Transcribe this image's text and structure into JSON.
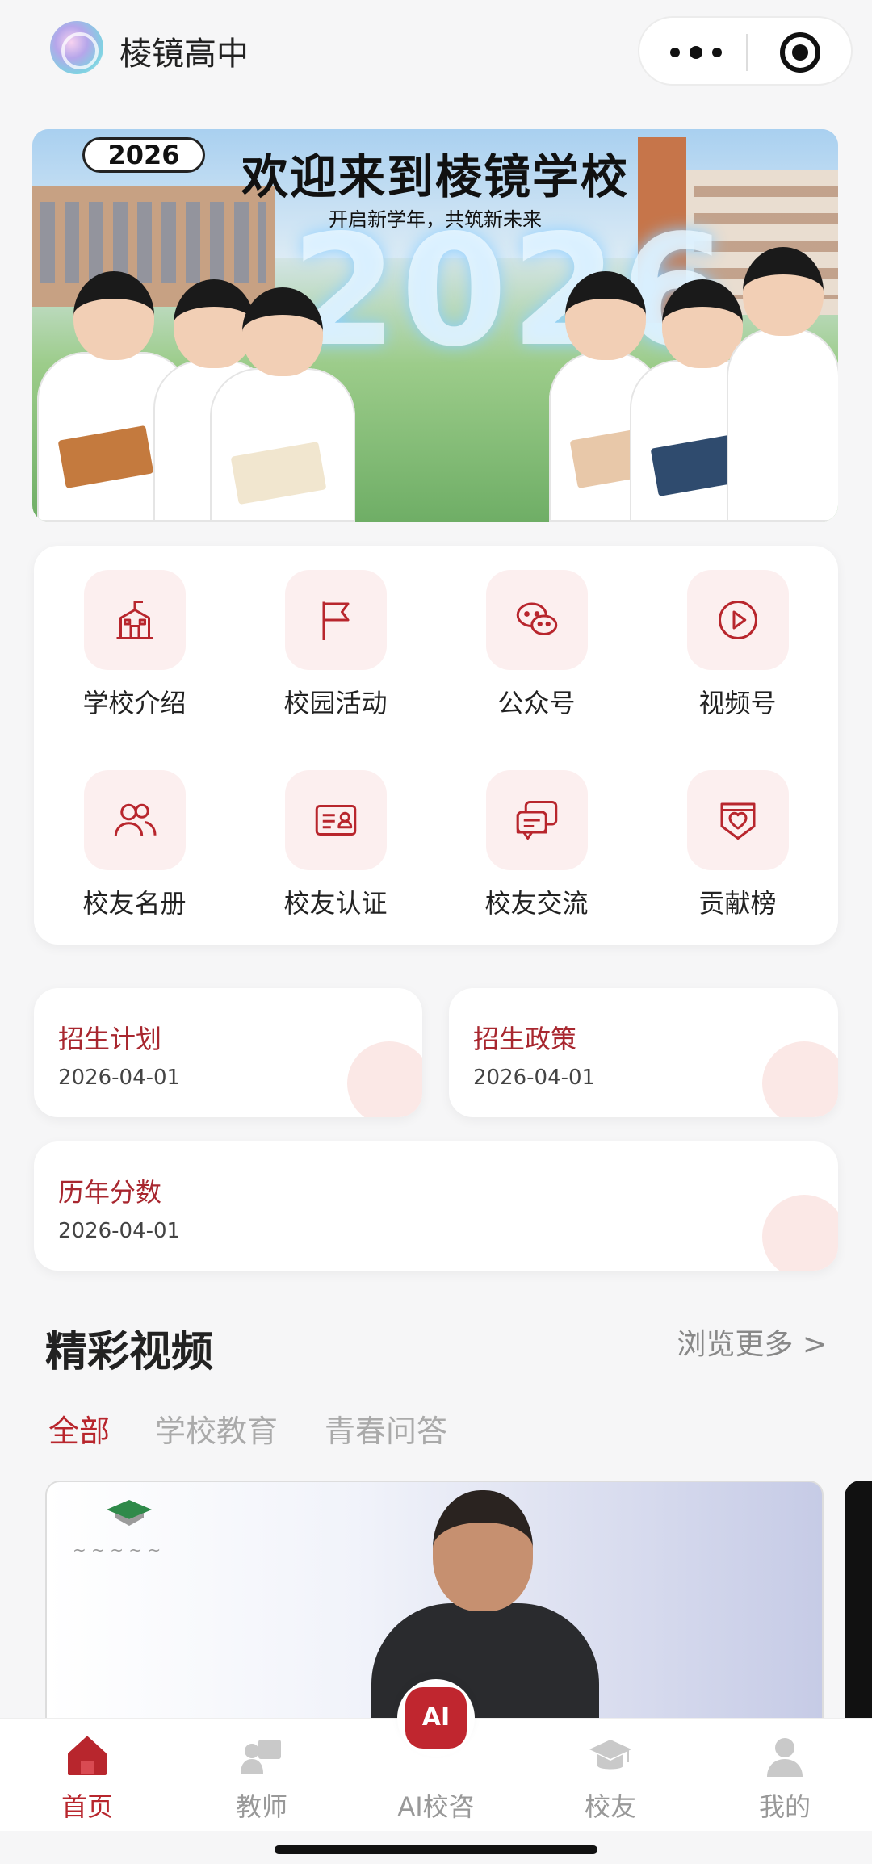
{
  "header": {
    "title": "棱镜高中"
  },
  "banner": {
    "year_badge": "2026",
    "headline": "欢迎来到棱镜学校",
    "subline": "开启新学年，共筑新未来",
    "big_year": "2026"
  },
  "menu": {
    "items": [
      {
        "label": "学校介绍",
        "icon": "school-icon"
      },
      {
        "label": "校园活动",
        "icon": "flag-icon"
      },
      {
        "label": "公众号",
        "icon": "wechat-icon"
      },
      {
        "label": "视频号",
        "icon": "play-icon"
      },
      {
        "label": "校友名册",
        "icon": "users-icon"
      },
      {
        "label": "校友认证",
        "icon": "id-card-icon"
      },
      {
        "label": "校友交流",
        "icon": "chat-icon"
      },
      {
        "label": "贡献榜",
        "icon": "heart-shield-icon"
      }
    ]
  },
  "info_cards": [
    {
      "title": "招生计划",
      "date": "2026-04-01"
    },
    {
      "title": "招生政策",
      "date": "2026-04-01"
    },
    {
      "title": "历年分数",
      "date": "2026-04-01"
    }
  ],
  "videos": {
    "section_title": "精彩视频",
    "more": "浏览更多 >",
    "tabs": [
      "全部",
      "学校教育",
      "青春问答"
    ],
    "active_tab": 0
  },
  "nav": {
    "items": [
      {
        "label": "首页",
        "icon": "home-icon"
      },
      {
        "label": "教师",
        "icon": "teacher-icon"
      },
      {
        "label": "AI校咨",
        "icon": "ai-icon"
      },
      {
        "label": "校友",
        "icon": "graduation-cap-icon"
      },
      {
        "label": "我的",
        "icon": "user-icon"
      }
    ],
    "ai_badge": "AI"
  },
  "colors": {
    "accent": "#b8262d",
    "icon_bg": "#fcefef",
    "background": "#f6f6f7"
  }
}
